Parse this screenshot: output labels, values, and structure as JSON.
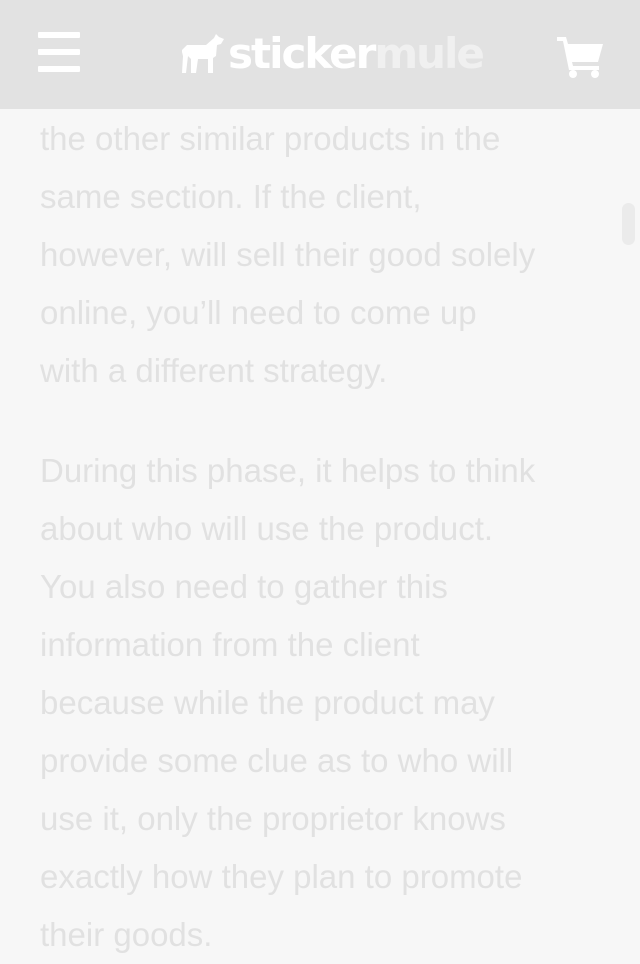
{
  "header": {
    "logo_word_1": "sticker",
    "logo_word_2": "mule",
    "logo_icon": "mule-icon",
    "menu_icon": "hamburger-menu-icon",
    "cart_icon": "shopping-cart-icon",
    "background_color": "#e2e2e2"
  },
  "article": {
    "paragraphs": [
      "the other similar products in the\nsame section. If the client,\nhowever, will sell their good solely\nonline, you’ll need to come up\nwith a different strategy.",
      "During this phase, it helps to think\nabout who will use the product.\nYou also need to gather this\ninformation from the client\nbecause while the product may\nprovide some clue as to who will\nuse it, only the proprietor knows\nexactly how they plan to promote\ntheir goods."
    ],
    "text_color": "#e1e1e1"
  }
}
